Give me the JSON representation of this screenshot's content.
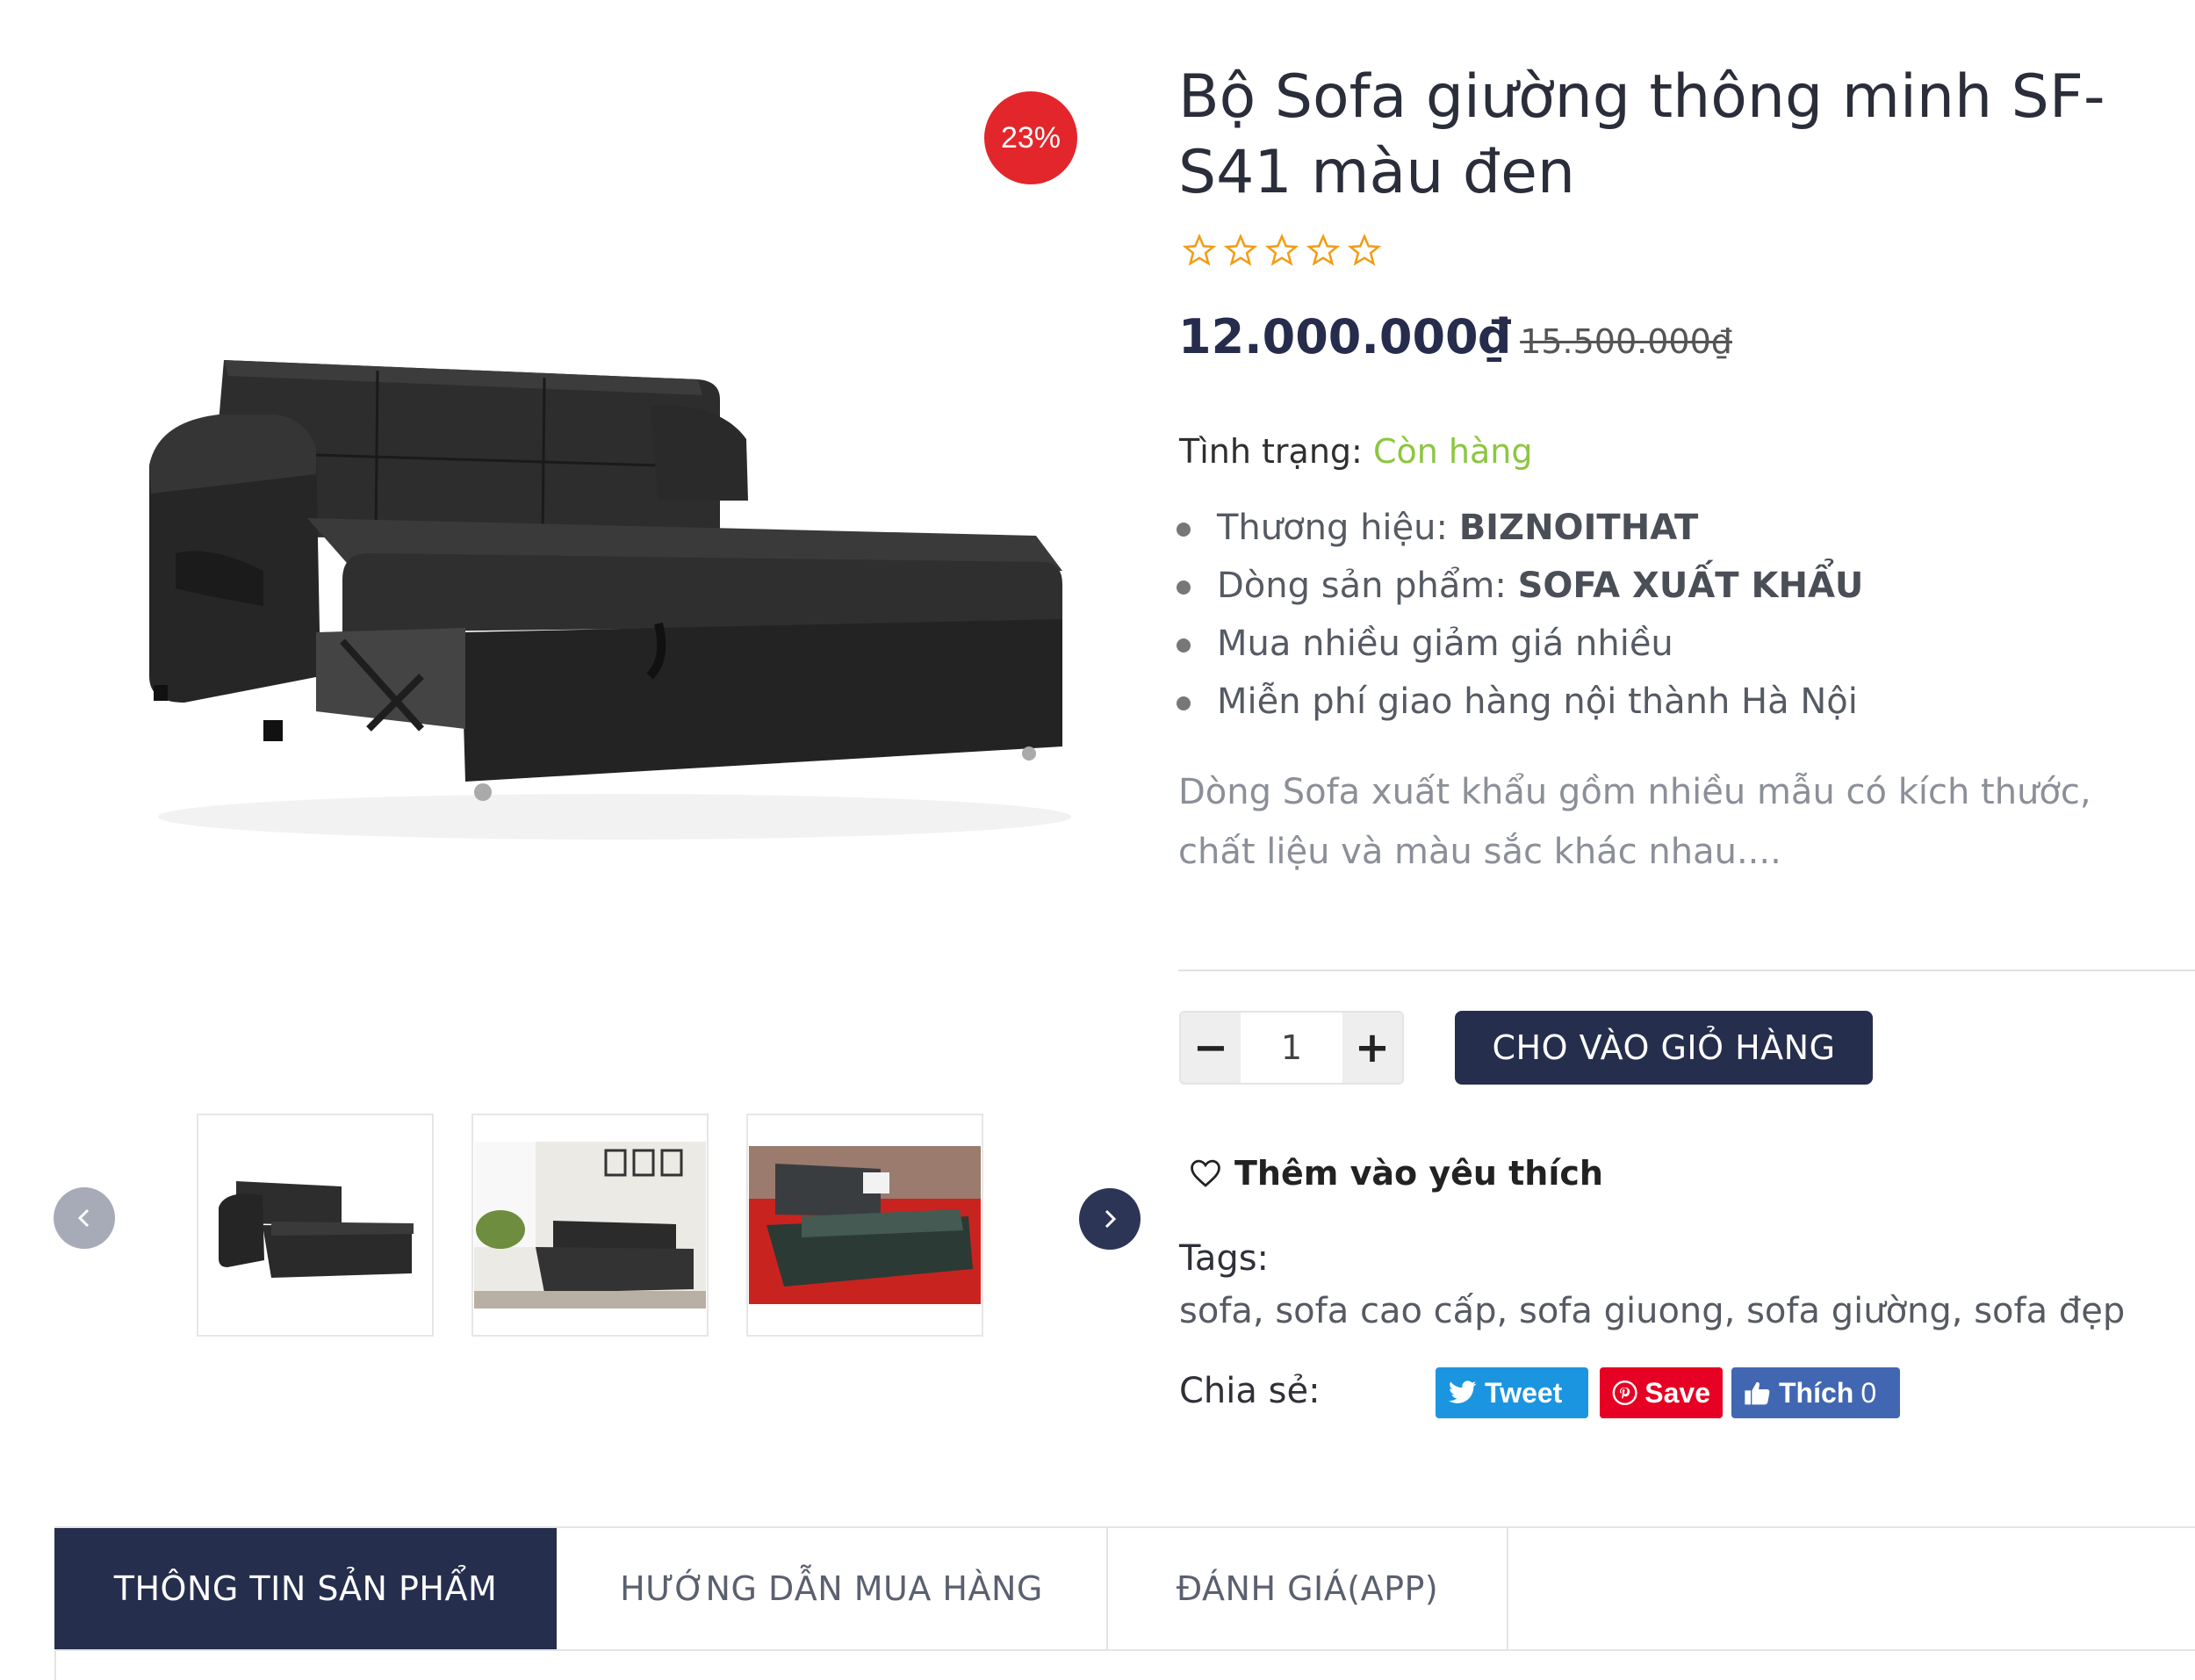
{
  "product": {
    "title": "Bộ Sofa giường thông minh SF-S41 màu đen",
    "discount_badge": "23%",
    "rating_stars": 0,
    "price_current": "12.000.000₫",
    "price_old": "15.500.000₫",
    "stock_label": "Tình trạng:",
    "stock_value": "Còn hàng",
    "features": [
      {
        "label": "Thương hiệu:",
        "value": "BIZNOITHAT"
      },
      {
        "label": "Dòng sản phẩm:",
        "value": "SOFA XUẤT KHẨU"
      },
      {
        "label": "Mua nhiều giảm giá nhiều",
        "value": ""
      },
      {
        "label": "Miễn phí giao hàng nội thành Hà Nội",
        "value": ""
      }
    ],
    "description": "Dòng Sofa xuất khẩu gồm nhiều mẫu có kích thước, chất liệu và màu sắc khác nhau...."
  },
  "cart": {
    "quantity": "1",
    "minus_label": "−",
    "plus_label": "+",
    "add_to_cart_label": "CHO VÀO GIỎ HÀNG"
  },
  "wishlist": {
    "label": "Thêm vào yêu thích"
  },
  "tags": {
    "label": "Tags:",
    "value": "sofa, sofa cao cấp, sofa giuong, sofa giường, sofa đẹp"
  },
  "share": {
    "label": "Chia sẻ:",
    "tweet": "Tweet",
    "save": "Save",
    "like": "Thích",
    "like_count": "0"
  },
  "tabs": [
    {
      "label": "THÔNG TIN SẢN PHẨM",
      "active": true
    },
    {
      "label": "HƯỚNG DẪN MUA HÀNG",
      "active": false
    },
    {
      "label": "ĐÁNH GIÁ(APP)",
      "active": false
    }
  ],
  "colors": {
    "accent_navy": "#262e4e",
    "sale_red": "#e3262b",
    "in_stock_green": "#8dc63f",
    "star_orange": "#f39c12",
    "twitter": "#1b95e0",
    "pinterest": "#e60023",
    "facebook": "#4267b2"
  },
  "icons": [
    "star-outline-icon",
    "heart-icon",
    "chevron-left-icon",
    "chevron-right-icon",
    "twitter-bird-icon",
    "pinterest-icon",
    "thumbs-up-icon"
  ]
}
